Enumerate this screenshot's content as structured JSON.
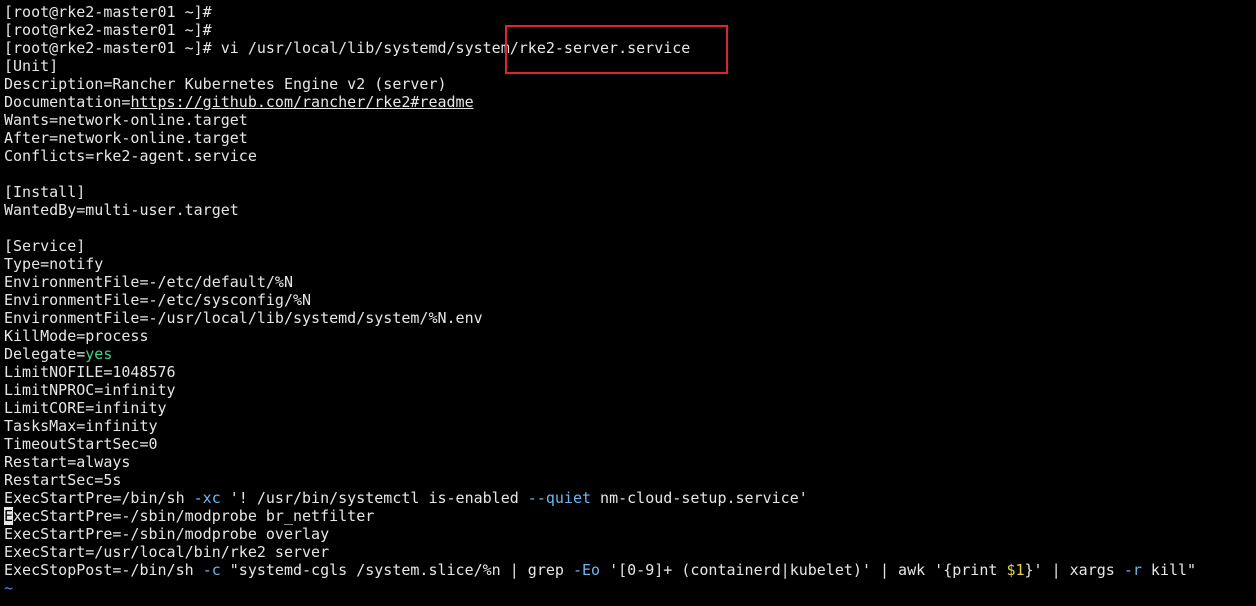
{
  "terminal": {
    "prompts": [
      "[root@rke2-master01 ~]#",
      "[root@rke2-master01 ~]#",
      "[root@rke2-master01 ~]# vi /usr/local/lib/systemd/system/rke2-server.service"
    ],
    "unit": {
      "header": "[Unit]",
      "description": "Description=Rancher Kubernetes Engine v2 (server)",
      "doc_key": "Documentation=",
      "doc_url": "https://github.com/rancher/rke2#readme",
      "wants": "Wants=network-online.target",
      "after": "After=network-online.target",
      "conflicts": "Conflicts=rke2-agent.service"
    },
    "install": {
      "header": "[Install]",
      "wantedby": "WantedBy=multi-user.target"
    },
    "service": {
      "header": "[Service]",
      "type": "Type=notify",
      "env1": "EnvironmentFile=-/etc/default/%N",
      "env2": "EnvironmentFile=-/etc/sysconfig/%N",
      "env3": "EnvironmentFile=-/usr/local/lib/systemd/system/%N.env",
      "killmode": "KillMode=process",
      "delegate_key": "Delegate=",
      "delegate_val": "yes",
      "limitnofile": "LimitNOFILE=1048576",
      "limitnproc": "LimitNPROC=infinity",
      "limitcore": "LimitCORE=infinity",
      "tasksmax": "TasksMax=infinity",
      "timeout": "TimeoutStartSec=0",
      "restart": "Restart=always",
      "restartsec": "RestartSec=5s",
      "pre1_a": "ExecStartPre=/bin/sh ",
      "pre1_opt": "-xc",
      "pre1_b": " '! /usr/bin/systemctl is-enabled ",
      "pre1_opt2": "--quiet",
      "pre1_c": " nm-cloud-setup.service'",
      "pre2_cursor": "E",
      "pre2_rest": "xecStartPre=-/sbin/modprobe br_netfilter",
      "pre3": "ExecStartPre=-/sbin/modprobe overlay",
      "start": "ExecStart=/usr/local/bin/rke2 server",
      "post_a": "ExecStopPost=-/bin/sh ",
      "post_opt1": "-c",
      "post_b": " \"systemd-cgls /system.slice/%n | grep ",
      "post_opt2": "-Eo",
      "post_c": " '[0-9]+ (containerd|kubelet)' | awk '{print ",
      "post_var": "$1",
      "post_d": "}' | xargs ",
      "post_opt3": "-r",
      "post_e": " kill\"",
      "tilde": "~"
    }
  },
  "colors": {
    "background": "#000000",
    "text": "#e6e6e6",
    "keyword_green": "#3fd28a",
    "option_blue": "#6fb8ef",
    "variable_yellow": "#e8d34a",
    "highlight_red": "#e0242b"
  }
}
